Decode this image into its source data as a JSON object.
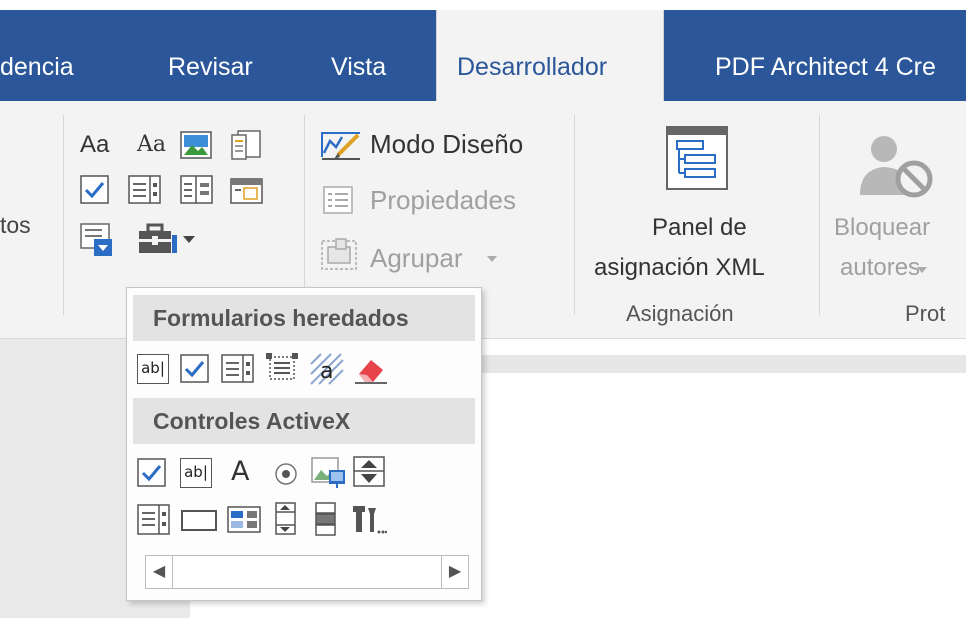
{
  "tabs": [
    {
      "label": "dencia"
    },
    {
      "label": "Revisar"
    },
    {
      "label": "Vista"
    },
    {
      "label": "Desarrollador"
    },
    {
      "label": "PDF Architect 4 Cre"
    }
  ],
  "ribbon": {
    "left_partial_label": "tos",
    "modo_diseno": "Modo Diseño",
    "propiedades": "Propiedades",
    "agrupar": "Agrupar",
    "panel_label_1": "Panel de",
    "panel_label_2": "asignación XML",
    "asignacion_group": "Asignación",
    "bloquear_1": "Bloquear",
    "bloquear_2": "autores",
    "proteger_group": "Prot",
    "small_text_icon_1": "Aa",
    "small_text_icon_2": "Aa"
  },
  "dropdown": {
    "header_legacy": "Formularios heredados",
    "header_activex": "Controles ActiveX",
    "text_icon_ab": "ab|",
    "text_icon_a": "A"
  },
  "colors": {
    "tab_bar": "#2b579a",
    "ribbon_bg": "#f3f3f3",
    "accent_blue": "#2b6cc4"
  }
}
